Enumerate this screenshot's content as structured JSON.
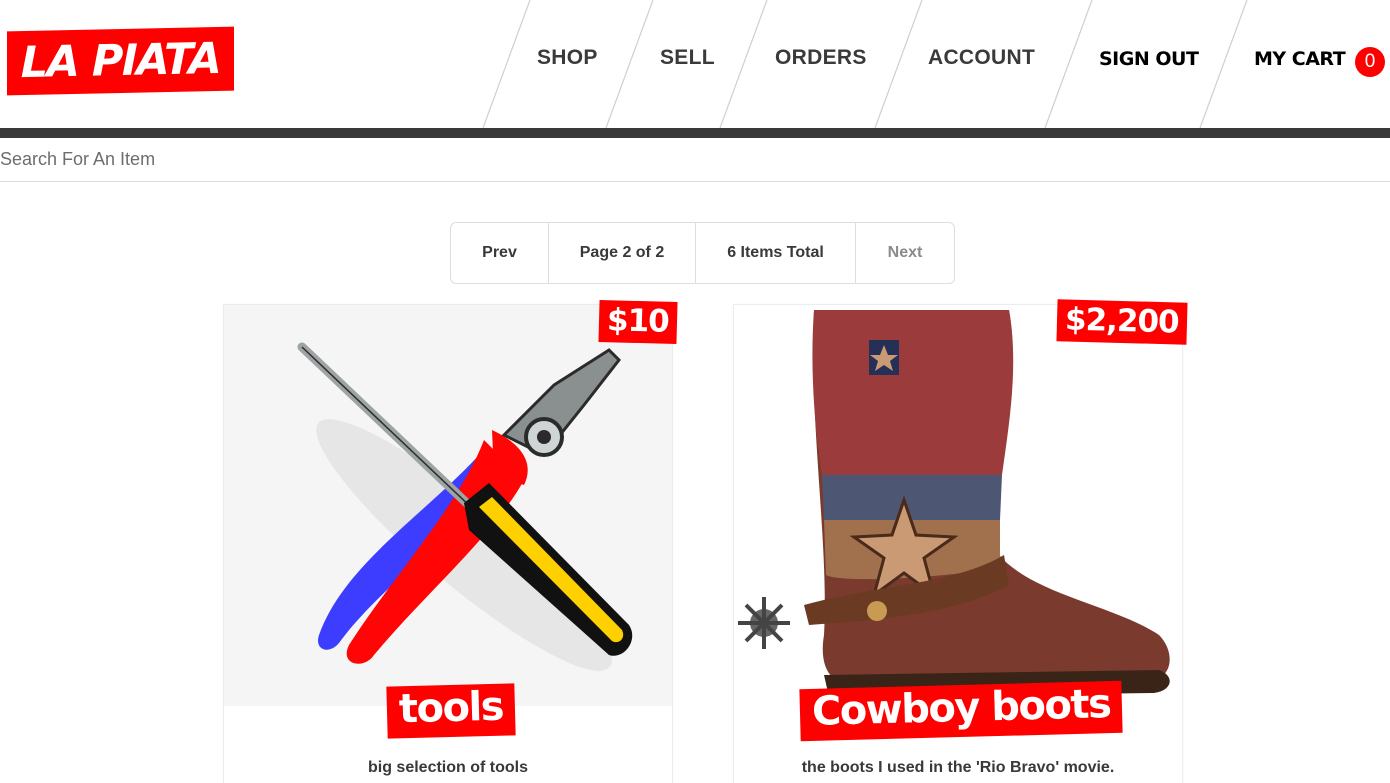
{
  "brand": {
    "logo_text": "LA PIATA",
    "accent_color": "#ff0000",
    "dark_color": "#393939"
  },
  "nav": {
    "items": [
      {
        "label": "SHOP"
      },
      {
        "label": "SELL"
      },
      {
        "label": "ORDERS"
      },
      {
        "label": "ACCOUNT"
      },
      {
        "label": "SIGN OUT"
      },
      {
        "label": "MY CART"
      }
    ],
    "cart_count": "0"
  },
  "search": {
    "placeholder": "Search For An Item",
    "value": ""
  },
  "pagination": {
    "prev_label": "Prev",
    "page_label": "Page 2 of 2",
    "total_label": "6 Items Total",
    "next_label": "Next"
  },
  "products": [
    {
      "title": "tools",
      "price": "$10",
      "description": "big selection of tools",
      "image_icon": "tools-image"
    },
    {
      "title": "Cowboy boots",
      "price": "$2,200",
      "description": "the boots I used in the 'Rio Bravo' movie.",
      "image_icon": "cowboy-boot-image"
    }
  ]
}
